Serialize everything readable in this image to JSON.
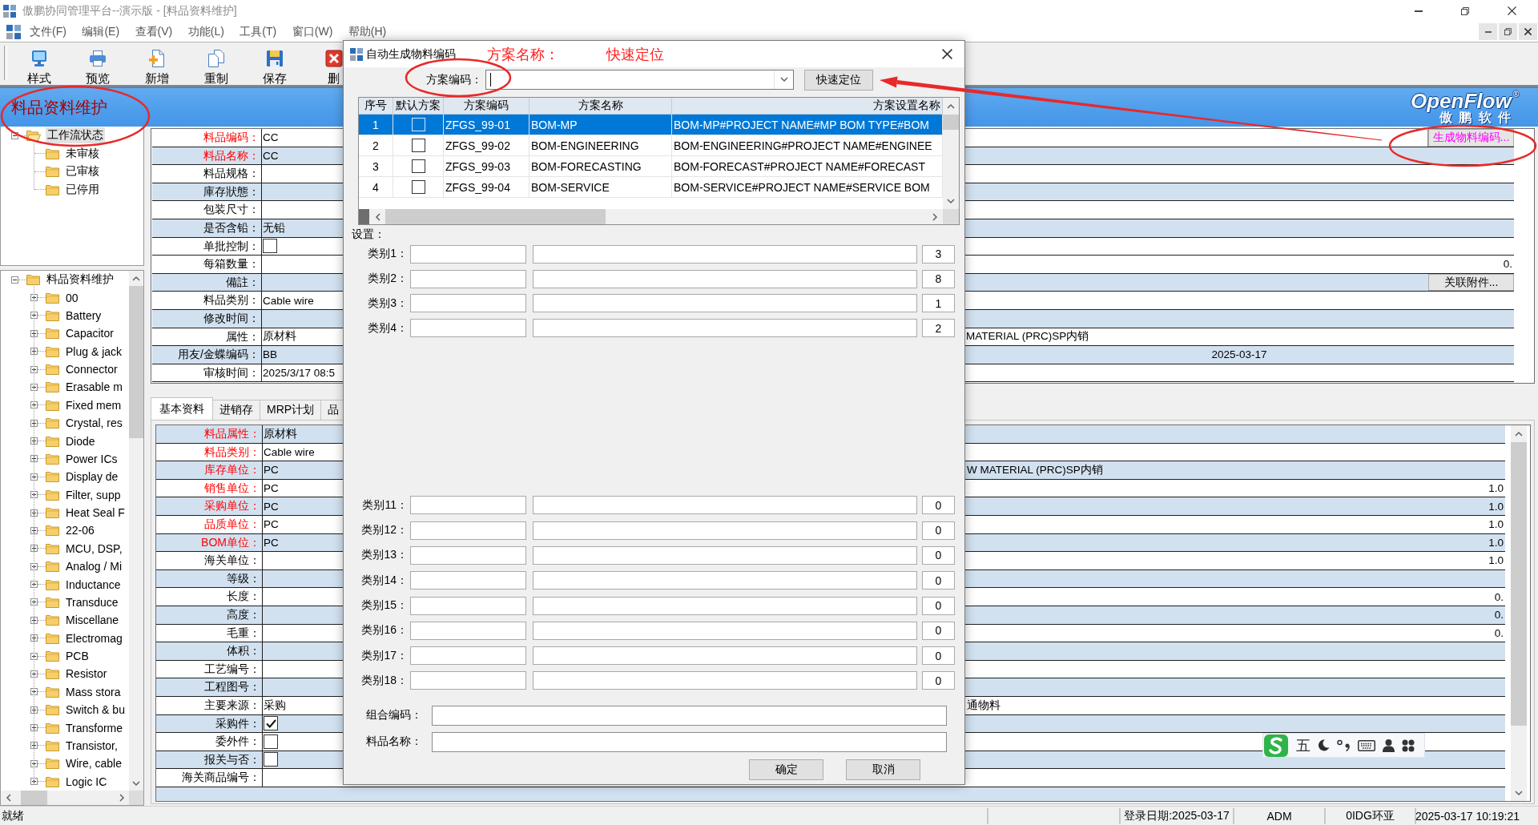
{
  "window": {
    "title": "傲鹏协同管理平台--演示版 - [料品资料维护]"
  },
  "menu": [
    "文件(F)",
    "编辑(E)",
    "查看(V)",
    "功能(L)",
    "工具(T)",
    "窗口(W)",
    "帮助(H)"
  ],
  "toolbar": [
    {
      "label": "样式",
      "kind": "monitor"
    },
    {
      "label": "预览",
      "kind": "printer"
    },
    {
      "label": "新增",
      "kind": "add"
    },
    {
      "label": "重制",
      "kind": "copy"
    },
    {
      "label": "保存",
      "kind": "save"
    },
    {
      "label": "删",
      "kind": "delete"
    }
  ],
  "header": {
    "title": "料品资料维护",
    "logo": "OpenFlow$^{®}$",
    "logo_subtitle": "傲 鹏 软 件"
  },
  "workflow_tree": {
    "label": "工作流状态",
    "selected": true,
    "expanded": true,
    "children": [
      {
        "label": "未审核",
        "selected": false
      },
      {
        "label": "已审核",
        "selected": false
      },
      {
        "label": "已停用",
        "selected": false
      }
    ]
  },
  "category_tree": {
    "label": "料品资料维护",
    "selected": false,
    "expanded": true,
    "children": [
      {
        "label": "00",
        "selected": false,
        "expanded": false
      },
      {
        "label": "Battery",
        "selected": false,
        "expanded": false
      },
      {
        "label": "Capacitor",
        "selected": false,
        "expanded": false
      },
      {
        "label": "Plug & jack",
        "selected": false,
        "expanded": false
      },
      {
        "label": "Connector",
        "selected": false,
        "expanded": false
      },
      {
        "label": "Erasable m",
        "selected": false,
        "expanded": false
      },
      {
        "label": "Fixed mem",
        "selected": false,
        "expanded": false
      },
      {
        "label": "Crystal, res",
        "selected": false,
        "expanded": false
      },
      {
        "label": "Diode",
        "selected": false,
        "expanded": false
      },
      {
        "label": "Power ICs",
        "selected": false,
        "expanded": false
      },
      {
        "label": "Display de",
        "selected": false,
        "expanded": false
      },
      {
        "label": "Filter, supp",
        "selected": false,
        "expanded": false
      },
      {
        "label": "Heat Seal F",
        "selected": false,
        "expanded": false
      },
      {
        "label": "22-06",
        "selected": false,
        "expanded": false
      },
      {
        "label": "MCU, DSP,",
        "selected": false,
        "expanded": false
      },
      {
        "label": "Analog / Mi",
        "selected": false,
        "expanded": false
      },
      {
        "label": "Inductance",
        "selected": false,
        "expanded": false
      },
      {
        "label": "Transduce",
        "selected": false,
        "expanded": false
      },
      {
        "label": "Miscellane",
        "selected": false,
        "expanded": false
      },
      {
        "label": "Electromag",
        "selected": false,
        "expanded": false
      },
      {
        "label": "PCB",
        "selected": false,
        "expanded": false
      },
      {
        "label": "Resistor",
        "selected": false,
        "expanded": false
      },
      {
        "label": "Mass stora",
        "selected": false,
        "expanded": false
      },
      {
        "label": "Switch & bu",
        "selected": false,
        "expanded": false
      },
      {
        "label": "Transforme",
        "selected": false,
        "expanded": false
      },
      {
        "label": "Transistor,",
        "selected": false,
        "expanded": false
      },
      {
        "label": "Wire, cable",
        "selected": false,
        "expanded": false
      },
      {
        "label": "Logic IC",
        "selected": false,
        "expanded": false
      }
    ]
  },
  "main_form": {
    "rows": [
      {
        "label": "料品编码：",
        "required": true,
        "shaded": false,
        "kind": "text",
        "value": "CC",
        "right": {
          "kind": "generator",
          "text": "生成物料编码..."
        }
      },
      {
        "label": "料品名称：",
        "required": true,
        "shaded": true,
        "kind": "text",
        "value": "CC"
      },
      {
        "label": "料品规格：",
        "required": false,
        "shaded": false,
        "kind": "text"
      },
      {
        "label": "庫存狀態：",
        "required": false,
        "shaded": true,
        "kind": "text"
      },
      {
        "label": "包装尺寸：",
        "required": false,
        "shaded": false,
        "kind": "text"
      },
      {
        "label": "是否含铅：",
        "required": false,
        "shaded": true,
        "kind": "text",
        "value": "无铅"
      },
      {
        "label": "单批控制：",
        "required": false,
        "shaded": false,
        "kind": "checkbox",
        "checked": false
      },
      {
        "label": "每箱数量：",
        "required": false,
        "shaded": false,
        "kind": "text",
        "right": {
          "kind": "number",
          "text": "0."
        }
      },
      {
        "label": "備註：",
        "required": false,
        "shaded": true,
        "kind": "text",
        "right": {
          "kind": "button",
          "text": "关联附件..."
        }
      },
      {
        "label": "料品类别：",
        "required": false,
        "shaded": false,
        "kind": "text",
        "value": "Cable wire"
      },
      {
        "label": "修改时间：",
        "required": false,
        "shaded": true,
        "kind": "text"
      },
      {
        "label": "属性：",
        "required": false,
        "shaded": false,
        "kind": "text",
        "value": "原材料",
        "right": {
          "kind": "text",
          "text": "MATERIAL (PRC)SP内销"
        }
      },
      {
        "label": "用友/金蝶编码：",
        "required": false,
        "shaded": true,
        "kind": "text",
        "value": "BB",
        "right": {
          "kind": "date",
          "text": "2025-03-17"
        }
      },
      {
        "label": "审核时间：",
        "required": false,
        "shaded": false,
        "kind": "text",
        "value": "2025/3/17 08:5"
      }
    ]
  },
  "tabs": [
    {
      "label": "基本资料",
      "selected": true
    },
    {
      "label": "进销存",
      "selected": false
    },
    {
      "label": "MRP计划",
      "selected": false
    },
    {
      "label": "品",
      "selected": false
    }
  ],
  "detail_form": {
    "rows": [
      {
        "label": "料品属性：",
        "required": true,
        "shaded": true,
        "kind": "text",
        "value": "原材料"
      },
      {
        "label": "料品类别：",
        "required": true,
        "shaded": false,
        "kind": "text",
        "value": "Cable wire"
      },
      {
        "label": "库存单位：",
        "required": true,
        "shaded": true,
        "kind": "text",
        "value": "PC",
        "right": {
          "kind": "text",
          "text": "W MATERIAL (PRC)SP内销"
        }
      },
      {
        "label": "销售单位：",
        "required": true,
        "shaded": false,
        "kind": "text",
        "value": "PC",
        "right": {
          "kind": "number",
          "text": "1.0"
        }
      },
      {
        "label": "采购单位：",
        "required": true,
        "shaded": true,
        "kind": "text",
        "value": "PC",
        "right": {
          "kind": "number",
          "text": "1.0"
        }
      },
      {
        "label": "品质单位：",
        "required": true,
        "shaded": false,
        "kind": "text",
        "value": "PC",
        "right": {
          "kind": "number",
          "text": "1.0"
        }
      },
      {
        "label": "BOM单位：",
        "required": true,
        "shaded": true,
        "kind": "text",
        "value": "PC",
        "right": {
          "kind": "number",
          "text": "1.0"
        }
      },
      {
        "label": "海关单位：",
        "required": false,
        "shaded": false,
        "kind": "text",
        "right": {
          "kind": "number",
          "text": "1.0"
        }
      },
      {
        "label": "等级：",
        "required": false,
        "shaded": true,
        "kind": "text"
      },
      {
        "label": "长度：",
        "required": false,
        "shaded": false,
        "kind": "text",
        "right": {
          "kind": "number",
          "text": "0."
        }
      },
      {
        "label": "高度：",
        "required": false,
        "shaded": true,
        "kind": "text",
        "right": {
          "kind": "number",
          "text": "0."
        }
      },
      {
        "label": "毛重：",
        "required": false,
        "shaded": false,
        "kind": "text",
        "right": {
          "kind": "number",
          "text": "0."
        }
      },
      {
        "label": "体积：",
        "required": false,
        "shaded": true,
        "kind": "text"
      },
      {
        "label": "工艺编号：",
        "required": false,
        "shaded": false,
        "kind": "text"
      },
      {
        "label": "工程图号：",
        "required": false,
        "shaded": true,
        "kind": "text"
      },
      {
        "label": "主要来源：",
        "required": false,
        "shaded": false,
        "kind": "text",
        "value": "采购",
        "right": {
          "kind": "text",
          "text": "通物料"
        }
      },
      {
        "label": "采购件：",
        "required": false,
        "shaded": true,
        "kind": "checkbox",
        "checked": true
      },
      {
        "label": "委外件：",
        "required": false,
        "shaded": false,
        "kind": "checkbox",
        "checked": false
      },
      {
        "label": "报关与否：",
        "required": false,
        "shaded": true,
        "kind": "checkbox",
        "checked": false
      },
      {
        "label": "海关商品编号：",
        "required": false,
        "shaded": false,
        "kind": "text"
      }
    ]
  },
  "dialog": {
    "title": "自动生成物料编码",
    "annotations": [
      "方案名称：",
      "快速定位"
    ],
    "scheme": {
      "label": "方案编码：",
      "focused": true
    },
    "locate_button": "快速定位",
    "grid": {
      "columns": [
        "序号",
        "默认方案",
        "方案编码",
        "方案名称",
        "方案设置名称"
      ],
      "rows": [
        {
          "no": "1",
          "default": false,
          "code": "ZFGS_99-01",
          "name": "BOM-MP",
          "setting": "BOM-MP#PROJECT NAME#MP BOM TYPE#BOM",
          "selected": true
        },
        {
          "no": "2",
          "default": false,
          "code": "ZFGS_99-02",
          "name": "BOM-ENGINEERING",
          "setting": "BOM-ENGINEERING#PROJECT NAME#ENGINEE",
          "selected": false
        },
        {
          "no": "3",
          "default": false,
          "code": "ZFGS_99-03",
          "name": "BOM-FORECASTING",
          "setting": "BOM-FORECAST#PROJECT NAME#FORECAST",
          "selected": false
        },
        {
          "no": "4",
          "default": false,
          "code": "ZFGS_99-04",
          "name": "BOM-SERVICE",
          "setting": "BOM-SERVICE#PROJECT NAME#SERVICE BOM",
          "selected": false
        }
      ]
    },
    "settings_label": "设置：",
    "category_groups": [
      [
        {
          "label": "类别1：",
          "value": "3"
        },
        {
          "label": "类别2：",
          "value": "8"
        },
        {
          "label": "类别3：",
          "value": "1"
        },
        {
          "label": "类别4：",
          "value": "2"
        }
      ],
      [
        {
          "label": "类别11：",
          "value": "0"
        },
        {
          "label": "类别12：",
          "value": "0"
        },
        {
          "label": "类别13：",
          "value": "0"
        },
        {
          "label": "类别14：",
          "value": "0"
        },
        {
          "label": "类别15：",
          "value": "0"
        },
        {
          "label": "类别16：",
          "value": "0"
        },
        {
          "label": "类别17：",
          "value": "0"
        },
        {
          "label": "类别18：",
          "value": "0"
        }
      ]
    ],
    "combined_code": {
      "label": "组合编码："
    },
    "item_name": {
      "label": "料品名称："
    },
    "buttons": [
      "确定",
      "取消"
    ]
  },
  "ime_bar": {
    "mode": "五"
  },
  "status_bar": {
    "message": "就绪",
    "panes": [
      "登录日期:2025-03-17",
      "ADM",
      "0IDG环亚",
      "2025-03-17 10:19:21"
    ]
  }
}
